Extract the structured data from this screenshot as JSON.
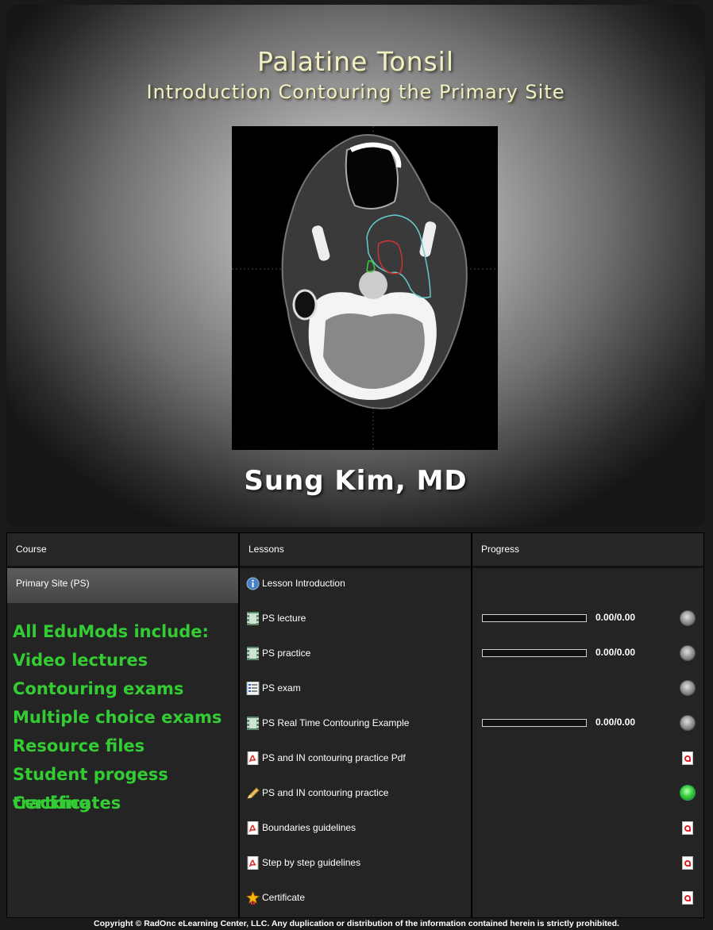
{
  "banner": {
    "title": "Palatine Tonsil",
    "subtitle": "Introduction Contouring the Primary Site",
    "author": "Sung Kim, MD"
  },
  "headers": {
    "course": "Course",
    "lessons": "Lessons",
    "progress": "Progress"
  },
  "course": {
    "item": "Primary Site (PS)",
    "features": [
      "All EduMods include:",
      "Video lectures",
      "Contouring exams",
      "Multiple choice exams",
      "Resource files",
      "Student progess tracking",
      "Certificates"
    ]
  },
  "lessons": [
    {
      "label": "Lesson Introduction",
      "icon": "info-icon"
    },
    {
      "label": "PS lecture",
      "icon": "film-icon"
    },
    {
      "label": "PS practice",
      "icon": "film-icon"
    },
    {
      "label": "PS exam",
      "icon": "checklist-icon"
    },
    {
      "label": "PS Real Time Contouring Example",
      "icon": "film-icon"
    },
    {
      "label": "PS and IN contouring practice Pdf",
      "icon": "pdf-icon"
    },
    {
      "label": "PS and IN contouring practice",
      "icon": "pencil-icon"
    },
    {
      "label": "Boundaries guidelines",
      "icon": "pdf-icon"
    },
    {
      "label": "Step by step guidelines",
      "icon": "pdf-icon"
    },
    {
      "label": "Certificate",
      "icon": "star-icon"
    }
  ],
  "progress": [
    {
      "kind": "none"
    },
    {
      "kind": "bar",
      "score": "0.00/0.00",
      "fraction": 0,
      "status": "grey"
    },
    {
      "kind": "bar",
      "score": "0.00/0.00",
      "fraction": 0,
      "status": "grey"
    },
    {
      "kind": "status",
      "status": "grey"
    },
    {
      "kind": "bar",
      "score": "0.00/0.00",
      "fraction": 0,
      "status": "grey"
    },
    {
      "kind": "pdf"
    },
    {
      "kind": "status",
      "status": "green"
    },
    {
      "kind": "pdf"
    },
    {
      "kind": "pdf"
    },
    {
      "kind": "pdf"
    }
  ],
  "footer": "Copyright © RadOnc eLearning Center, LLC. Any duplication or distribution of the information contained herein is strictly prohibited."
}
